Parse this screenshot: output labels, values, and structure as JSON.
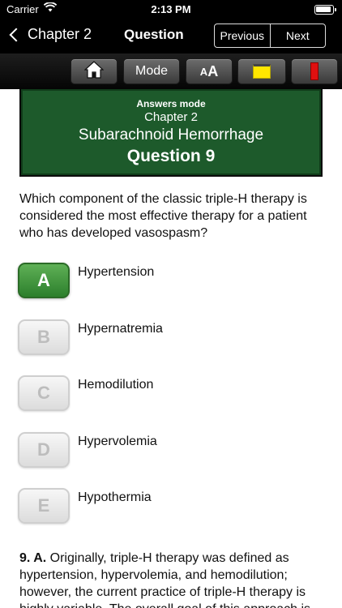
{
  "status_bar": {
    "carrier": "Carrier",
    "time": "2:13 PM"
  },
  "nav": {
    "back_label": "Chapter 2",
    "title": "Question",
    "previous_label": "Previous",
    "next_label": "Next"
  },
  "toolbar": {
    "home_icon": "home-icon",
    "mode_label": "Mode",
    "font_small": "A",
    "font_large": "A",
    "note_icon": "note-icon",
    "bookmark_icon": "bookmark-icon",
    "note_color": "#ffe600",
    "bookmark_color": "#e01010"
  },
  "header": {
    "mode_text": "Answers mode",
    "chapter": "Chapter 2",
    "topic": "Subarachnoid Hemorrhage",
    "question_number": "Question 9",
    "bg_color": "#1d5a2b"
  },
  "question_text": "Which component of the classic triple-H therapy is considered the most effective therapy for a patient who has developed vasospasm?",
  "options": [
    {
      "key": "A",
      "label": "Hypertension",
      "selected": true
    },
    {
      "key": "B",
      "label": "Hypernatremia",
      "selected": false
    },
    {
      "key": "C",
      "label": "Hemodilution",
      "selected": false
    },
    {
      "key": "D",
      "label": "Hypervolemia",
      "selected": false
    },
    {
      "key": "E",
      "label": "Hypothermia",
      "selected": false
    }
  ],
  "explanation": {
    "answer_ref": "9. A.",
    "text": "Originally, triple-H therapy was defined as hypertension, hypervolemia, and hemodilution; however, the current practice of triple-H therapy is highly variable. The overall goal of this approach is"
  }
}
